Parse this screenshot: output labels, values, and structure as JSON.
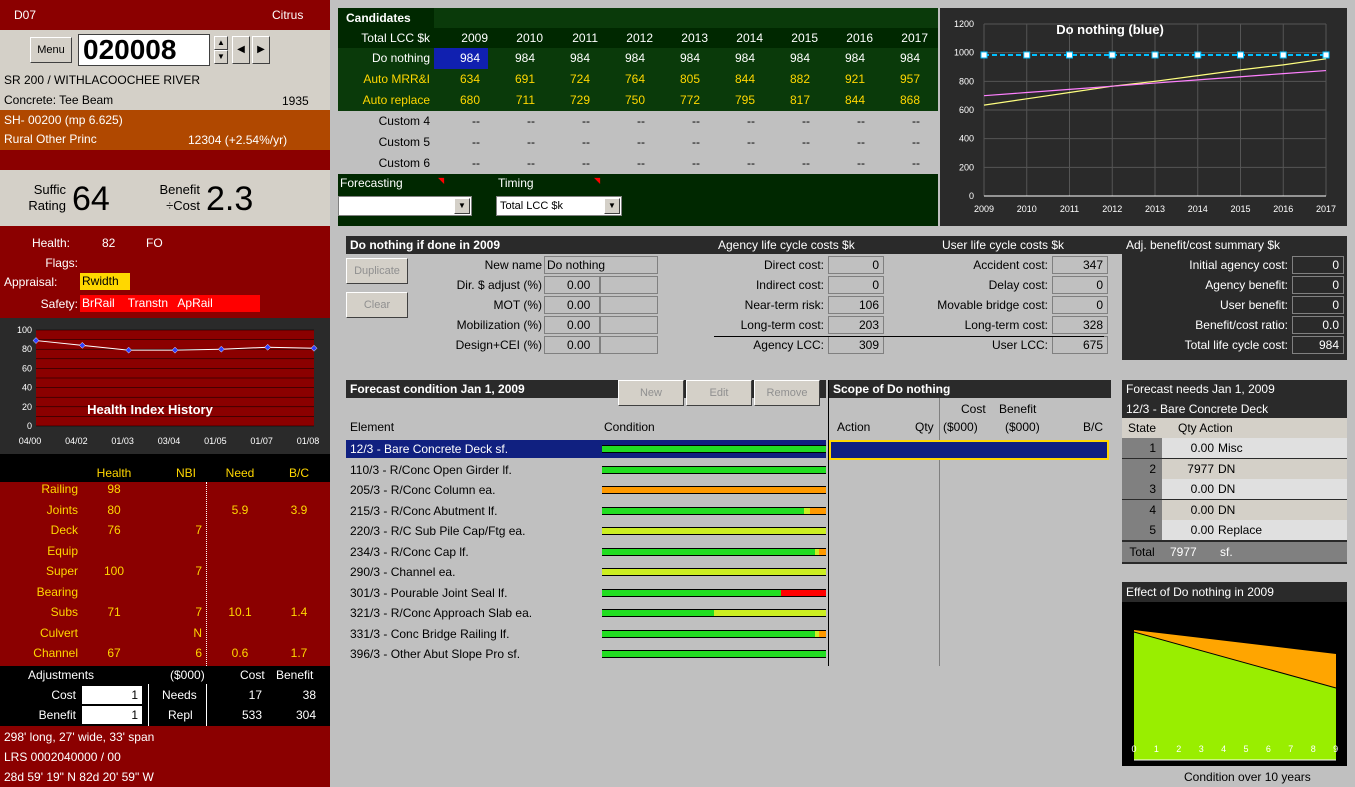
{
  "left": {
    "id": "D07",
    "county": "Citrus",
    "menu_label": "Menu",
    "bridge_no": "020008",
    "name": "SR 200 / WITHLACOOCHEE RIVER",
    "type": "Concrete: Tee Beam",
    "year": "1935",
    "route": "SH- 00200  (mp 6.625)",
    "func_class": "Rural Other Princ",
    "adt": "12304 (+2.54%/yr)",
    "suffic_label1": "Suffic",
    "suffic_label2": "Rating",
    "suffic": "64",
    "bc_label1": "Benefit",
    "bc_label2": "÷Cost",
    "bc": "2.3",
    "health_label": "Health:",
    "health": "82",
    "health_code": "FO",
    "flags_label": "Flags:",
    "appraisal_label": "Appraisal:",
    "appraisal": "Rwidth",
    "safety_label": "Safety:",
    "safety": [
      "BrRail",
      "Transtn",
      "ApRail"
    ],
    "chart_title": "Health Index History",
    "hdr": [
      "Health",
      "NBI",
      "Need",
      "B/C"
    ],
    "rows": [
      {
        "name": "Railing",
        "health": "98",
        "nbi": "",
        "need": "",
        "bc": ""
      },
      {
        "name": "Joints",
        "health": "80",
        "nbi": "",
        "need": "5.9",
        "bc": "3.9"
      },
      {
        "name": "Deck",
        "health": "76",
        "nbi": "7",
        "need": "",
        "bc": ""
      },
      {
        "name": "Equip",
        "health": "",
        "nbi": "",
        "need": "",
        "bc": ""
      },
      {
        "name": "Super",
        "health": "100",
        "nbi": "7",
        "need": "",
        "bc": ""
      },
      {
        "name": "Bearing",
        "health": "",
        "nbi": "",
        "need": "",
        "bc": ""
      },
      {
        "name": "Subs",
        "health": "71",
        "nbi": "7",
        "need": "10.1",
        "bc": "1.4"
      },
      {
        "name": "Culvert",
        "health": "",
        "nbi": "N",
        "need": "",
        "bc": ""
      },
      {
        "name": "Channel",
        "health": "67",
        "nbi": "6",
        "need": "0.6",
        "bc": "1.7"
      }
    ],
    "adj_label": "Adjustments",
    "adj_unit": "($000)",
    "adj_cost_hdr": "Cost",
    "adj_benefit_hdr": "Benefit",
    "cost_label": "Cost",
    "cost_val": "1",
    "needs_label": "Needs",
    "needs_cost": "17",
    "needs_benefit": "38",
    "benefit_label": "Benefit",
    "benefit_val": "1",
    "repl_label": "Repl",
    "repl_cost": "533",
    "repl_benefit": "304",
    "dims": "298' long, 27' wide, 33' span",
    "lrs": "LRS 0002040000 / 00",
    "coords": "28d 59' 19\" N  82d 20' 59\" W"
  },
  "health_chart": {
    "type": "line",
    "title": "Health Index History",
    "categories": [
      "04/00",
      "04/02",
      "01/03",
      "03/04",
      "01/05",
      "01/07",
      "01/08"
    ],
    "y_ticks": [
      "100",
      "80",
      "60",
      "40",
      "20",
      "0"
    ],
    "ylim": [
      0,
      100
    ],
    "values": [
      89,
      84,
      79,
      79,
      80,
      82,
      81
    ]
  },
  "candidates": {
    "title": "Candidates",
    "row_header": "Total LCC $k",
    "years": [
      "2009",
      "2010",
      "2011",
      "2012",
      "2013",
      "2014",
      "2015",
      "2016",
      "2017"
    ],
    "rows": [
      {
        "name": "Do nothing",
        "values": [
          "984",
          "984",
          "984",
          "984",
          "984",
          "984",
          "984",
          "984",
          "984"
        ]
      },
      {
        "name": "Auto MRR&I",
        "values": [
          "634",
          "691",
          "724",
          "764",
          "805",
          "844",
          "882",
          "921",
          "957"
        ]
      },
      {
        "name": "Auto replace",
        "values": [
          "680",
          "711",
          "729",
          "750",
          "772",
          "795",
          "817",
          "844",
          "868"
        ]
      },
      {
        "name": "Custom 4",
        "values": [
          "--",
          "--",
          "--",
          "--",
          "--",
          "--",
          "--",
          "--",
          "--"
        ]
      },
      {
        "name": "Custom 5",
        "values": [
          "--",
          "--",
          "--",
          "--",
          "--",
          "--",
          "--",
          "--",
          "--"
        ]
      },
      {
        "name": "Custom 6",
        "values": [
          "--",
          "--",
          "--",
          "--",
          "--",
          "--",
          "--",
          "--",
          "--"
        ]
      }
    ],
    "forecasting_label": "Forecasting",
    "forecasting_value": "",
    "timing_label": "Timing",
    "timing_value": "Total LCC $k"
  },
  "lcc_chart": {
    "type": "line",
    "title": "Do nothing (blue)",
    "x": [
      "2009",
      "2010",
      "2011",
      "2012",
      "2013",
      "2014",
      "2015",
      "2016",
      "2017"
    ],
    "y_ticks": [
      "1200",
      "1000",
      "800",
      "600",
      "400",
      "200",
      "0"
    ],
    "ylim": [
      0,
      1200
    ],
    "series": [
      {
        "name": "Do nothing",
        "color": "#00bfff",
        "values": [
          984,
          984,
          984,
          984,
          984,
          984,
          984,
          984,
          984
        ]
      },
      {
        "name": "Auto MRR&I",
        "color": "#ff80ff",
        "values": [
          700,
          722,
          744,
          766,
          788,
          810,
          832,
          854,
          875
        ]
      },
      {
        "name": "Auto replace",
        "color": "#ffff80",
        "values": [
          634,
          678,
          722,
          766,
          800,
          840,
          880,
          915,
          957
        ]
      }
    ]
  },
  "scenario": {
    "title": "Do nothing if done in 2009",
    "duplicate": "Duplicate",
    "clear": "Clear",
    "new_name_label": "New name",
    "new_name": "Do nothing",
    "fields": [
      {
        "label": "Dir. $ adjust (%)",
        "value": "0.00"
      },
      {
        "label": "MOT (%)",
        "value": "0.00"
      },
      {
        "label": "Mobilization (%)",
        "value": "0.00"
      },
      {
        "label": "Design+CEI (%)",
        "value": "0.00"
      }
    ],
    "agency_title": "Agency life cycle costs $k",
    "agency": [
      {
        "label": "Direct cost:",
        "value": "0"
      },
      {
        "label": "Indirect cost:",
        "value": "0"
      },
      {
        "label": "Near-term risk:",
        "value": "106"
      },
      {
        "label": "Long-term cost:",
        "value": "203"
      },
      {
        "label": "Agency LCC:",
        "value": "309"
      }
    ],
    "user_title": "User life cycle costs $k",
    "user": [
      {
        "label": "Accident cost:",
        "value": "347"
      },
      {
        "label": "Delay cost:",
        "value": "0"
      },
      {
        "label": "Movable bridge cost:",
        "value": "0"
      },
      {
        "label": "Long-term cost:",
        "value": "328"
      },
      {
        "label": "User LCC:",
        "value": "675"
      }
    ],
    "summary_title": "Adj. benefit/cost summary $k",
    "summary": [
      {
        "label": "Initial agency cost:",
        "value": "0"
      },
      {
        "label": "Agency benefit:",
        "value": "0"
      },
      {
        "label": "User benefit:",
        "value": "0"
      },
      {
        "label": "Benefit/cost ratio:",
        "value": "0.0"
      },
      {
        "label": "Total life cycle cost:",
        "value": "984"
      }
    ]
  },
  "forecast": {
    "title": "Forecast condition Jan 1, 2009",
    "new": "New",
    "edit": "Edit",
    "remove": "Remove",
    "col_element": "Element",
    "col_condition": "Condition",
    "elements": [
      {
        "name": "12/3 - Bare Concrete Deck sf.",
        "green": 1.0,
        "yellow": 0,
        "orange": 0,
        "red": 0
      },
      {
        "name": "110/3 - R/Conc Open Girder lf.",
        "green": 1.0,
        "yellow": 0,
        "orange": 0,
        "red": 0
      },
      {
        "name": "205/3 - R/Conc Column ea.",
        "green": 0,
        "yellow": 0,
        "orange": 1.0,
        "red": 0
      },
      {
        "name": "215/3 - R/Conc Abutment lf.",
        "green": 0.9,
        "yellow": 0.03,
        "orange": 0.07,
        "red": 0
      },
      {
        "name": "220/3 - R/C Sub Pile Cap/Ftg ea.",
        "green": 0,
        "yellow": 1.0,
        "orange": 0,
        "red": 0
      },
      {
        "name": "234/3 - R/Conc Cap lf.",
        "green": 0.95,
        "yellow": 0.02,
        "orange": 0.03,
        "red": 0
      },
      {
        "name": "290/3 - Channel ea.",
        "green": 0,
        "yellow": 1.0,
        "orange": 0,
        "red": 0
      },
      {
        "name": "301/3 - Pourable Joint Seal lf.",
        "green": 0.8,
        "yellow": 0,
        "orange": 0,
        "red": 0.2
      },
      {
        "name": "321/3 - R/Conc Approach Slab ea.",
        "green": 0.5,
        "yellow": 0.5,
        "orange": 0,
        "red": 0
      },
      {
        "name": "331/3 - Conc Bridge Railing lf.",
        "green": 0.95,
        "yellow": 0.02,
        "orange": 0.03,
        "red": 0
      },
      {
        "name": "396/3 - Other Abut Slope Pro sf.",
        "green": 1.0,
        "yellow": 0,
        "orange": 0,
        "red": 0
      }
    ]
  },
  "scope": {
    "title": "Scope of Do nothing",
    "cost_hdr": "Cost",
    "benefit_hdr": "Benefit",
    "action": "Action",
    "qty": "Qty",
    "cost_unit": "($000)",
    "benefit_unit": "($000)",
    "bc": "B/C"
  },
  "needs": {
    "title": "Forecast needs Jan 1, 2009",
    "element": "12/3 - Bare Concrete Deck",
    "hdr_state": "State",
    "hdr_qty_action": "Qty  Action",
    "rows": [
      {
        "state": "1",
        "qty": "0.00",
        "action": "Misc"
      },
      {
        "state": "2",
        "qty": "7977",
        "action": "DN"
      },
      {
        "state": "3",
        "qty": "0.00",
        "action": "DN"
      },
      {
        "state": "4",
        "qty": "0.00",
        "action": "DN"
      },
      {
        "state": "5",
        "qty": "0.00",
        "action": "Replace"
      }
    ],
    "total_label": "Total",
    "total_qty": "7977",
    "total_unit": "sf."
  },
  "effect": {
    "title": "Effect of Do nothing in 2009",
    "caption": "Condition over 10 years",
    "x_ticks": [
      "0",
      "1",
      "2",
      "3",
      "4",
      "5",
      "6",
      "7",
      "8",
      "9"
    ]
  }
}
